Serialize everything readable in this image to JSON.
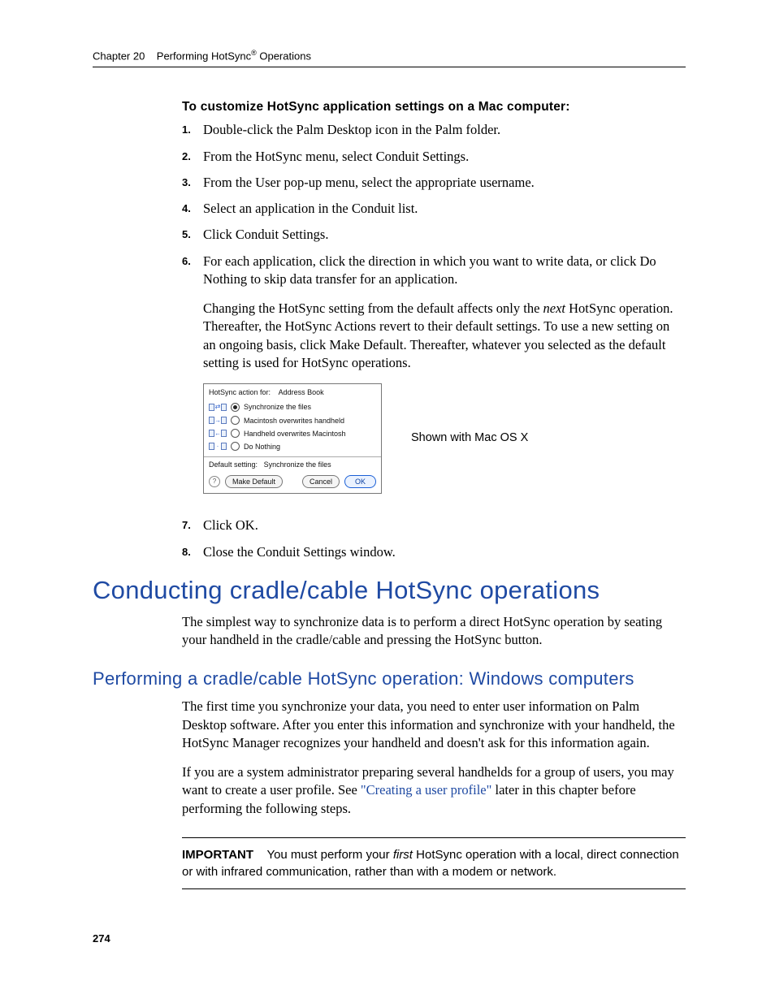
{
  "running_head": {
    "chapter_label": "Chapter 20",
    "title_pre": "Performing HotSync",
    "title_post": " Operations"
  },
  "procedure": {
    "title": "To customize HotSync application settings on a Mac computer:",
    "steps": [
      "Double-click the Palm Desktop icon in the Palm folder.",
      "From the HotSync menu, select Conduit Settings.",
      "From the User pop-up menu, select the appropriate username.",
      "Select an application in the Conduit list.",
      "Click Conduit Settings.",
      "For each application, click the direction in which you want to write data, or click Do Nothing to skip data transfer for an application."
    ],
    "step6_extra_pre": "Changing the HotSync setting from the default affects only the ",
    "step6_extra_em": "next",
    "step6_extra_post": " HotSync operation. Thereafter, the HotSync Actions revert to their default settings. To use a new setting on an ongoing basis, click Make Default. Thereafter, whatever you selected as the default setting is used for HotSync operations.",
    "steps_after": [
      "Click OK.",
      "Close the Conduit Settings window."
    ]
  },
  "dialog": {
    "header_label": "HotSync action for:",
    "header_value": "Address Book",
    "options": [
      "Synchronize the files",
      "Macintosh overwrites handheld",
      "Handheld overwrites Macintosh",
      "Do Nothing"
    ],
    "default_label": "Default setting:",
    "default_value": "Synchronize the files",
    "make_default": "Make Default",
    "cancel": "Cancel",
    "ok": "OK",
    "caption": "Shown with Mac OS X"
  },
  "section": {
    "title": "Conducting cradle/cable HotSync operations",
    "intro": "The simplest way to synchronize data is to perform a direct HotSync operation by seating your handheld in the cradle/cable and pressing the HotSync button."
  },
  "subsection": {
    "title": "Performing a cradle/cable HotSync operation: Windows computers",
    "p1": "The first time you synchronize your data, you need to enter user information on Palm Desktop software. After you enter this information and synchronize with your handheld, the HotSync Manager recognizes your handheld and doesn't ask for this information again.",
    "p2_pre": "If you are a system administrator preparing several handhelds for a group of users, you may want to create a user profile. See ",
    "p2_link": "\"Creating a user profile\"",
    "p2_post": " later in this chapter before performing the following steps."
  },
  "important": {
    "label": "IMPORTANT",
    "pre": "You must perform your ",
    "em": "first",
    "post": " HotSync operation with a local, direct connection or with infrared communication, rather than with a modem or network."
  },
  "page_number": "274"
}
